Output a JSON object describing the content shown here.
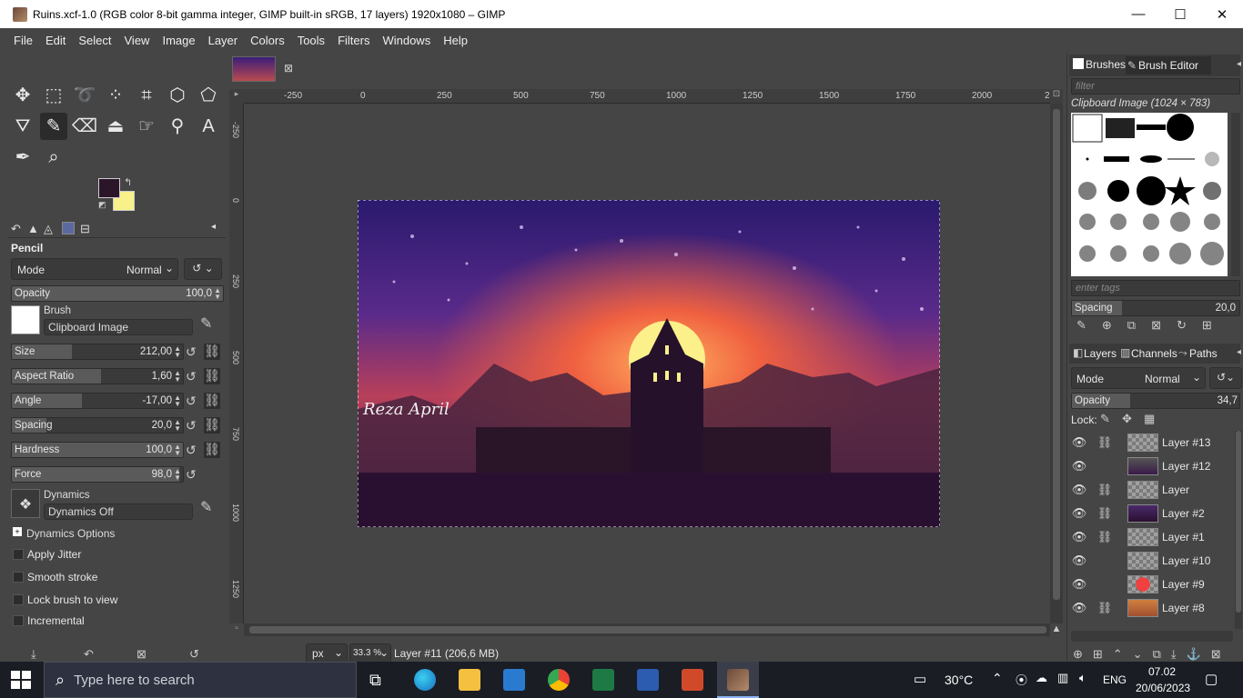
{
  "window": {
    "title": "Ruins.xcf-1.0 (RGB color 8-bit gamma integer, GIMP built-in sRGB, 17 layers) 1920x1080 – GIMP",
    "minimize": "—",
    "maximize": "☐",
    "close": "✕"
  },
  "menu": [
    "File",
    "Edit",
    "Select",
    "View",
    "Image",
    "Layer",
    "Colors",
    "Tools",
    "Filters",
    "Windows",
    "Help"
  ],
  "tool_options": {
    "title": "Pencil",
    "mode_label": "Mode",
    "mode_value": "Normal",
    "opacity": {
      "label": "Opacity",
      "value": "100,0",
      "fraction": 1.0
    },
    "brush_label": "Brush",
    "brush_name": "Clipboard Image",
    "sliders": [
      {
        "label": "Size",
        "value": "212,00",
        "fraction": 0.35
      },
      {
        "label": "Aspect Ratio",
        "value": "1,60",
        "fraction": 0.52
      },
      {
        "label": "Angle",
        "value": "-17,00",
        "fraction": 0.41
      },
      {
        "label": "Spacing",
        "value": "20,0",
        "fraction": 0.2
      },
      {
        "label": "Hardness",
        "value": "100,0",
        "fraction": 1.0
      },
      {
        "label": "Force",
        "value": "98,0",
        "fraction": 0.98
      }
    ],
    "dynamics_label": "Dynamics",
    "dynamics_value": "Dynamics Off",
    "dynamics_options": "Dynamics Options",
    "checks": [
      "Apply Jitter",
      "Smooth stroke",
      "Lock brush to view",
      "Incremental"
    ]
  },
  "colors": {
    "fg": "#2b1528",
    "bg": "#f8f08a",
    "accent": "#5a5a5a"
  },
  "rulers": {
    "h": [
      "-250",
      "0",
      "250",
      "500",
      "750",
      "1000",
      "1250",
      "1500",
      "1750",
      "2000",
      "2"
    ],
    "v": [
      "-250",
      "0",
      "250",
      "500",
      "750",
      "1000",
      "1250"
    ]
  },
  "canvas": {
    "signature": "Reza April"
  },
  "status": {
    "unit": "px",
    "zoom": "33.3 %",
    "layer_info": "Layer #11 (206,6 MB)"
  },
  "brushes_panel": {
    "tabs": [
      "Brushes",
      "Brush Editor"
    ],
    "filter_placeholder": "filter",
    "current_brush": "Clipboard Image (1024 × 783)",
    "tags_placeholder": "enter tags",
    "spacing_label": "Spacing",
    "spacing_value": "20,0"
  },
  "layers_panel": {
    "tabs": [
      "Layers",
      "Channels",
      "Paths"
    ],
    "mode_label": "Mode",
    "mode_value": "Normal",
    "opacity_label": "Opacity",
    "opacity_value": "34,7",
    "lock_label": "Lock:",
    "layers": [
      {
        "name": "Layer #13",
        "chain": true
      },
      {
        "name": "Layer #12",
        "chain": false
      },
      {
        "name": "Layer",
        "chain": true
      },
      {
        "name": "Layer #2",
        "chain": true
      },
      {
        "name": "Layer #1",
        "chain": true
      },
      {
        "name": "Layer #10",
        "chain": false
      },
      {
        "name": "Layer #9",
        "chain": false
      },
      {
        "name": "Layer #8",
        "chain": true
      }
    ]
  },
  "taskbar": {
    "search_placeholder": "Type here to search",
    "temperature": "30°C",
    "language": "ENG",
    "time": "07.02",
    "date": "20/06/2023"
  }
}
